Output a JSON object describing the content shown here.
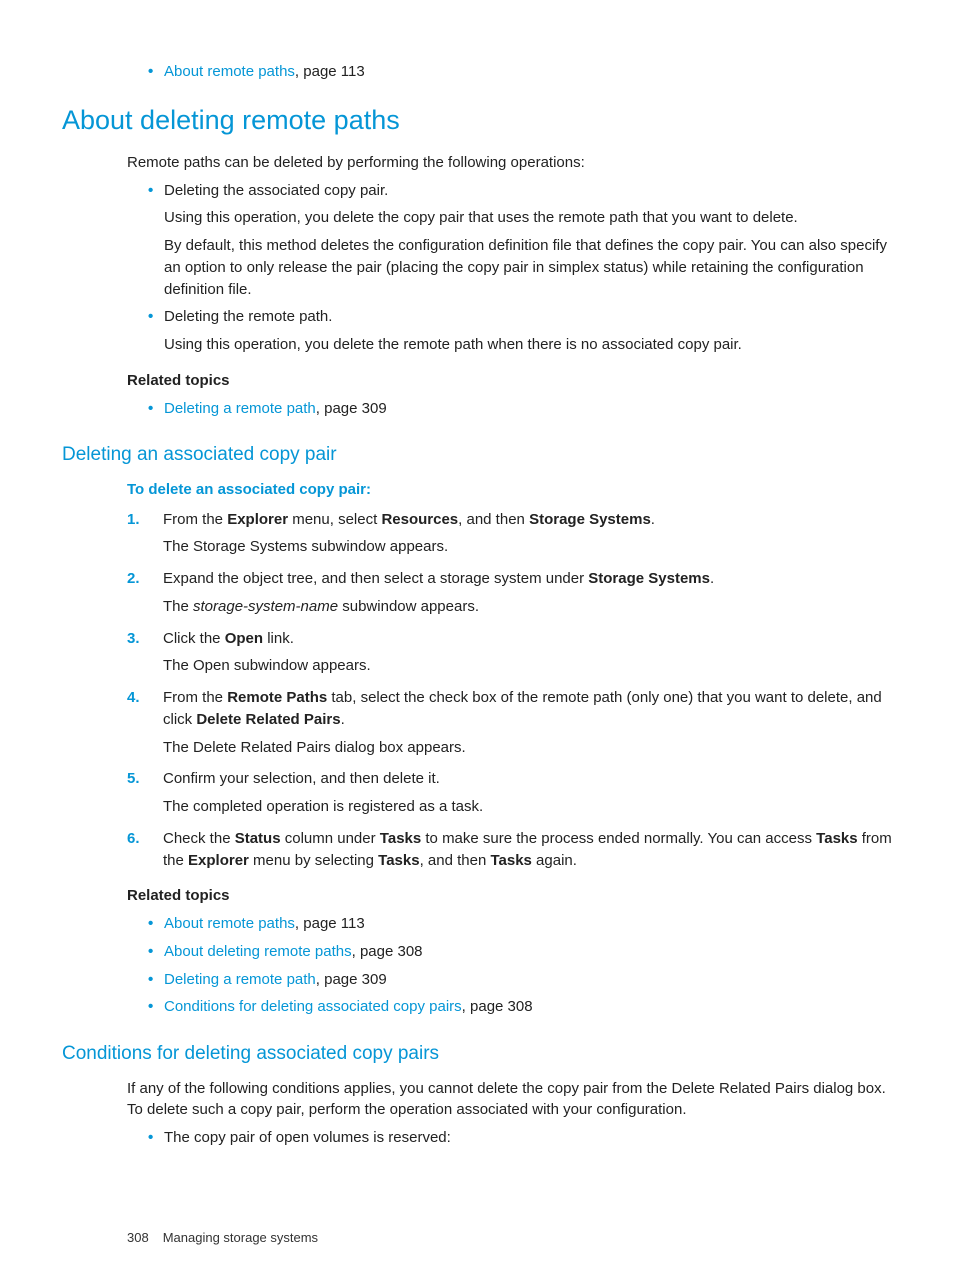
{
  "topref": {
    "link": "About remote paths",
    "suffix": ", page 113"
  },
  "h1": "About deleting remote paths",
  "intro": "Remote paths can be deleted by performing the following operations:",
  "ops": [
    {
      "title": "Deleting the associated copy pair.",
      "p1": "Using this operation, you delete the copy pair that uses the remote path that you want to delete.",
      "p2": "By default, this method deletes the configuration definition file that defines the copy pair. You can also specify an option to only release the pair (placing the copy pair in simplex status) while retaining the configuration definition file."
    },
    {
      "title": "Deleting the remote path.",
      "p1": "Using this operation, you delete the remote path when there is no associated copy pair.",
      "p2": ""
    }
  ],
  "related1_label": "Related topics",
  "related1": {
    "link": "Deleting a remote path",
    "suffix": ", page 309"
  },
  "h2a": "Deleting an associated copy pair",
  "procedure_label": "To delete an associated copy pair:",
  "steps": {
    "s1": {
      "pre": "From the ",
      "b1": "Explorer",
      "mid1": " menu, select ",
      "b2": "Resources",
      "mid2": ", and then ",
      "b3": "Storage Systems",
      "post": ".",
      "sub": "The Storage Systems subwindow appears."
    },
    "s2": {
      "pre": "Expand the object tree, and then select a storage system under ",
      "b1": "Storage Systems",
      "post": ".",
      "sub_pre": "The ",
      "sub_i": "storage-system-name",
      "sub_post": " subwindow appears."
    },
    "s3": {
      "pre": "Click the ",
      "b1": "Open",
      "post": " link.",
      "sub": "The Open subwindow appears."
    },
    "s4": {
      "pre": "From the ",
      "b1": "Remote Paths",
      "mid": " tab, select the check box of the remote path (only one) that you want to delete, and click ",
      "b2": "Delete Related Pairs",
      "post": ".",
      "sub": "The Delete Related Pairs dialog box appears."
    },
    "s5": {
      "text": "Confirm your selection, and then delete it.",
      "sub": "The completed operation is registered as a task."
    },
    "s6": {
      "pre": "Check the ",
      "b1": "Status",
      "mid1": " column under ",
      "b2": "Tasks",
      "mid2": " to make sure the process ended normally. You can access ",
      "b3": "Tasks",
      "mid3": " from the ",
      "b4": "Explorer",
      "mid4": " menu by selecting ",
      "b5": "Tasks",
      "mid5": ", and then ",
      "b6": "Tasks",
      "post": " again."
    }
  },
  "related2_label": "Related topics",
  "related2": [
    {
      "link": "About remote paths",
      "suffix": ", page 113"
    },
    {
      "link": "About deleting remote paths",
      "suffix": ", page 308"
    },
    {
      "link": "Deleting a remote path",
      "suffix": ", page 309"
    },
    {
      "link": "Conditions for deleting associated copy pairs",
      "suffix": ", page 308"
    }
  ],
  "h2b": "Conditions for deleting associated copy pairs",
  "cond_intro": "If any of the following conditions applies, you cannot delete the copy pair from the Delete Related Pairs dialog box. To delete such a copy pair, perform the operation associated with your configuration.",
  "cond_item": "The copy pair of open volumes is reserved:",
  "footer": {
    "page": "308",
    "title": "Managing storage systems"
  }
}
